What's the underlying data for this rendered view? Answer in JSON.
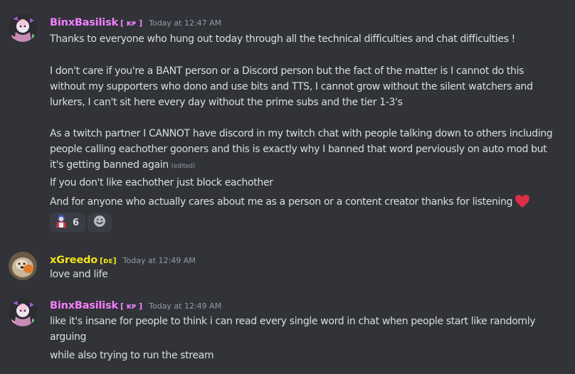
{
  "colors": {
    "background": "#313338",
    "binx_name": "#f47fff",
    "greedo_name": "#f1e31a",
    "text": "#dbdee1",
    "muted": "#949ba4",
    "heart": "#dd2e44"
  },
  "messages": [
    {
      "author": "BinxBasilisk",
      "tag": "[ ᴋᴘ ]",
      "timestamp": "Today at 12:47 AM",
      "lines": [
        "Thanks to everyone who hung out today through all the technical difficulties and chat difficulties !",
        "I don't care if you're a BANT person or a Discord person but the fact of the matter is I cannot do this",
        "without my supporters who dono and use bits and TTS, I cannot grow without the silent watchers and",
        "lurkers, I can't sit here every day without the prime subs and the tier 1-3's",
        "As a twitch partner I CANNOT have discord in my twitch chat with people talking down to others including",
        "people calling eachother gooners and this is exactly why I banned that word perviously on auto mod but",
        "it's getting banned again",
        "If you don't like eachother just block eachother",
        "And for anyone who actually cares about me as a person or a content creator thanks for listening"
      ],
      "edited_label": "(edited)",
      "heart_icon": "red-heart-icon",
      "reaction": {
        "emoji_icon": "custom-emote-icon",
        "count": "6"
      },
      "add_reaction_icon": "smiley-face-icon"
    },
    {
      "author": "xGreedo",
      "tag": "[ᴅᴇ]",
      "timestamp": "Today at 12:49 AM",
      "lines": [
        "love and life"
      ]
    },
    {
      "author": "BinxBasilisk",
      "tag": "[ ᴋᴘ ]",
      "timestamp": "Today at 12:49 AM",
      "lines": [
        "like it's insane for people to think i can read every single word in chat when people start like randomly",
        "arguing",
        "while also trying to run the stream"
      ]
    }
  ]
}
